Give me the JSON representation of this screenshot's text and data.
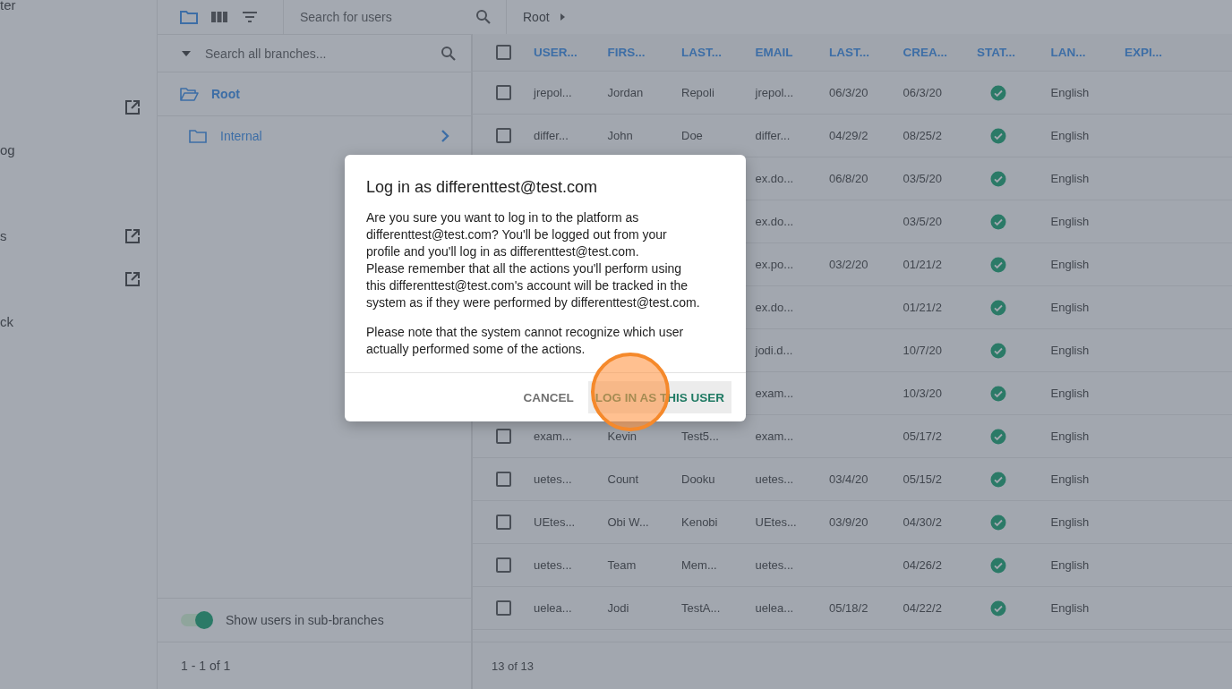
{
  "sidebar": {
    "items": [
      {
        "kind": "text",
        "label": "ter"
      },
      {
        "kind": "blank"
      },
      {
        "kind": "link"
      },
      {
        "kind": "text",
        "label": "og"
      },
      {
        "kind": "blank"
      },
      {
        "kind": "text_link",
        "label": "s"
      },
      {
        "kind": "link"
      },
      {
        "kind": "text",
        "label": "ck"
      }
    ]
  },
  "toolbar": {
    "views": [
      {
        "kind": "folder",
        "selected": true
      },
      {
        "kind": "columns",
        "selected": false
      },
      {
        "kind": "filter",
        "selected": false
      }
    ],
    "search": {
      "placeholder": "Search for users"
    },
    "breadcrumb": [
      "Root"
    ]
  },
  "branches": {
    "search": {
      "placeholder": "Search all branches..."
    },
    "items": [
      {
        "label": "Root",
        "expanded": true,
        "children": [
          {
            "label": "Internal",
            "expanded": false,
            "has_children": true
          }
        ]
      }
    ],
    "sub_branches_toggle": {
      "label": "Show users in sub-branches",
      "on": true
    },
    "pagination": "1 - 1 of 1"
  },
  "table": {
    "header_checkbox": {
      "checked": false
    },
    "columns": [
      "USER...",
      "FIRS...",
      "LAST...",
      "EMAIL",
      "LAST...",
      "CREA...",
      "STAT...",
      "LAN...",
      "EXPI..."
    ],
    "rows": [
      {
        "checked": false,
        "cells": [
          "jrepol...",
          "Jordan",
          "Repoli",
          "jrepol...",
          "06/3/20",
          "06/3/20"
        ],
        "active": true,
        "language": "English"
      },
      {
        "checked": false,
        "cells": [
          "differ...",
          "John",
          "Doe",
          "differ...",
          "04/29/2",
          "08/25/2"
        ],
        "active": true,
        "language": "English"
      },
      {
        "cells": [
          null,
          null,
          null,
          "ex.do...",
          "06/8/20",
          "03/5/20"
        ],
        "active": true,
        "language": "English"
      },
      {
        "cells": [
          null,
          null,
          null,
          "ex.do...",
          null,
          "03/5/20"
        ],
        "active": true,
        "language": "English"
      },
      {
        "cells": [
          null,
          null,
          null,
          "ex.po...",
          "03/2/20",
          "01/21/2"
        ],
        "active": true,
        "language": "English"
      },
      {
        "cells": [
          null,
          null,
          null,
          "ex.do...",
          null,
          "01/21/2"
        ],
        "active": true,
        "language": "English"
      },
      {
        "cells": [
          null,
          null,
          null,
          "jodi.d...",
          null,
          "10/7/20"
        ],
        "active": true,
        "language": "English"
      },
      {
        "cells": [
          null,
          null,
          null,
          "exam...",
          null,
          "10/3/20"
        ],
        "active": true,
        "language": "English"
      },
      {
        "checked": false,
        "cells": [
          "exam...",
          "Kevin",
          "Test5...",
          "exam...",
          null,
          "05/17/2"
        ],
        "active": true,
        "language": "English"
      },
      {
        "checked": false,
        "cells": [
          "uetes...",
          "Count",
          "Dooku",
          "uetes...",
          "03/4/20",
          "05/15/2"
        ],
        "active": true,
        "language": "English"
      },
      {
        "checked": false,
        "cells": [
          "UEtes...",
          "Obi W...",
          "Kenobi",
          "UEtes...",
          "03/9/20",
          "04/30/2"
        ],
        "active": true,
        "language": "English"
      },
      {
        "checked": false,
        "cells": [
          "uetes...",
          "Team",
          "Mem...",
          "uetes...",
          null,
          "04/26/2"
        ],
        "active": true,
        "language": "English"
      },
      {
        "checked": false,
        "cells": [
          "uelea...",
          "Jodi",
          "TestA...",
          "uelea...",
          "05/18/2",
          "04/22/2"
        ],
        "active": true,
        "language": "English"
      }
    ],
    "footer": "13 of 13"
  },
  "dialog": {
    "title": "Log in as differenttest@test.com",
    "paragraphs": [
      {
        "text": "Are you sure you want to log in to the platform as differenttest@test.com? You'll be logged out from your profile and you'll log in as differenttest@test.com.",
        "spaced": false
      },
      {
        "text": "Please remember that all the actions you'll perform using this differenttest@test.com's account will be tracked in the system as if they were performed by differenttest@test.com.",
        "spaced": false
      },
      {
        "text": "Please note that the system cannot recognize which user actually performed some of the actions.",
        "spaced": true
      }
    ],
    "buttons": [
      {
        "label": "CANCEL",
        "kind": "secondary"
      },
      {
        "label": "LOG IN AS THIS USER",
        "kind": "primary"
      }
    ],
    "click_marker": true
  }
}
